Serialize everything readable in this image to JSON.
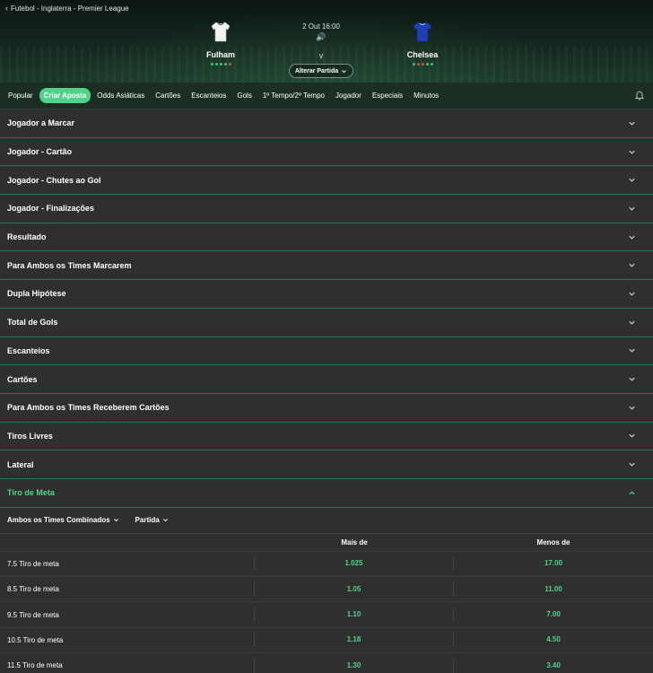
{
  "breadcrumb": {
    "text": "Futebol - Inglaterra - Premier League"
  },
  "match": {
    "home": {
      "name": "Fulham",
      "form": [
        "#2ecc71",
        "#2ecc71",
        "#2ecc71",
        "#2ecc71",
        "#e74c3c"
      ]
    },
    "away": {
      "name": "Chelsea",
      "form": [
        "#2ecc71",
        "#e74c3c",
        "#e74c3c",
        "#2ecc71",
        "#2ecc71"
      ]
    },
    "time": "2 Out 16:00",
    "versus": "v",
    "change_button": "Alterar Partida"
  },
  "tabs": [
    {
      "label": "Popular"
    },
    {
      "label": "Criar Aposta"
    },
    {
      "label": "Odds Asiáticas"
    },
    {
      "label": "Cartões"
    },
    {
      "label": "Escanteios"
    },
    {
      "label": "Gols"
    },
    {
      "label": "1º Tempo/2º Tempo"
    },
    {
      "label": "Jogador"
    },
    {
      "label": "Especiais"
    },
    {
      "label": "Minutos"
    }
  ],
  "markets": [
    {
      "label": "Jogador a Marcar"
    },
    {
      "label": "Jogador - Cartão"
    },
    {
      "label": "Jogador - Chutes ao Gol"
    },
    {
      "label": "Jogador - Finalizações"
    },
    {
      "label": "Resultado"
    },
    {
      "label": "Para Ambos os Times Marcarem"
    },
    {
      "label": "Dupla Hipótese"
    },
    {
      "label": "Total de Gols"
    },
    {
      "label": "Escanteios"
    },
    {
      "label": "Cartões"
    },
    {
      "label": "Para Ambos os Times Receberem Cartões"
    },
    {
      "label": "Tiros Livres"
    },
    {
      "label": "Lateral"
    }
  ],
  "open_market": {
    "label": "Tiro de Meta",
    "filters": [
      "Ambos os Times Combinados",
      "Partida"
    ],
    "columns": [
      "Mais de",
      "Menos de"
    ],
    "rows": [
      {
        "line": "7.5 Tiro de meta",
        "over": "1.025",
        "under": "17.00"
      },
      {
        "line": "8.5 Tiro de meta",
        "over": "1.05",
        "under": "11.00"
      },
      {
        "line": "9.5 Tiro de meta",
        "over": "1.10",
        "under": "7.00"
      },
      {
        "line": "10.5 Tiro de meta",
        "over": "1.18",
        "under": "4.50"
      },
      {
        "line": "11.5 Tiro de meta",
        "over": "1.30",
        "under": "3.40"
      }
    ]
  },
  "colors": {
    "accent": "#4fd28a",
    "tabs_bg": "#1c2e24",
    "panel_bg": "#2f2f2f",
    "divider": "#1f7a4d"
  },
  "icons": {
    "back": "chevron-left-icon",
    "sound": "speaker-icon",
    "bell": "bell-icon",
    "expand": "chevron-down-icon",
    "collapse": "chevron-up-icon"
  }
}
